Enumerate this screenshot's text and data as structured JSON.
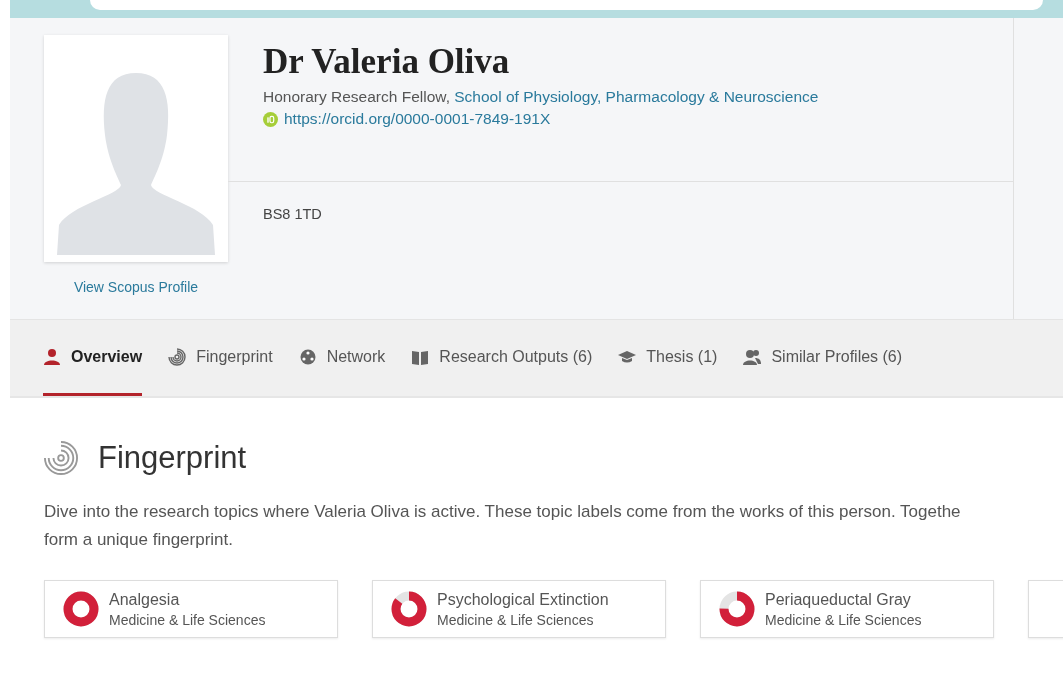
{
  "profile": {
    "name": "Dr Valeria Oliva",
    "role": "Honorary Research Fellow,",
    "department": "School of Physiology, Pharmacology & Neuroscience",
    "orcid": "https://orcid.org/0000-0001-7849-191X",
    "postcode": "BS8 1TD",
    "scopus_link": "View Scopus Profile"
  },
  "tabs": [
    {
      "label": "Overview",
      "kind": "overview",
      "selected": true
    },
    {
      "label": "Fingerprint",
      "kind": "fingerprint",
      "selected": false
    },
    {
      "label": "Network",
      "kind": "network",
      "selected": false
    },
    {
      "label": "Research Outputs (6)",
      "kind": "outputs",
      "selected": false
    },
    {
      "label": "Thesis (1)",
      "kind": "thesis",
      "selected": false
    },
    {
      "label": "Similar Profiles (6)",
      "kind": "profiles",
      "selected": false
    }
  ],
  "fingerprint": {
    "title": "Fingerprint",
    "intro_lines": [
      "Dive into the research topics where Valeria Oliva is active. These topic labels come from the works of this person. Togethe",
      "form a unique fingerprint."
    ],
    "topics": [
      {
        "name": "Analgesia",
        "category": "Medicine & Life Sciences",
        "level": 1
      },
      {
        "name": "Psychological Extinction",
        "category": "Medicine & Life Sciences",
        "level": 0.85
      },
      {
        "name": "Periaqueductal Gray",
        "category": "Medicine & Life Sciences",
        "level": 0.75
      }
    ]
  }
}
